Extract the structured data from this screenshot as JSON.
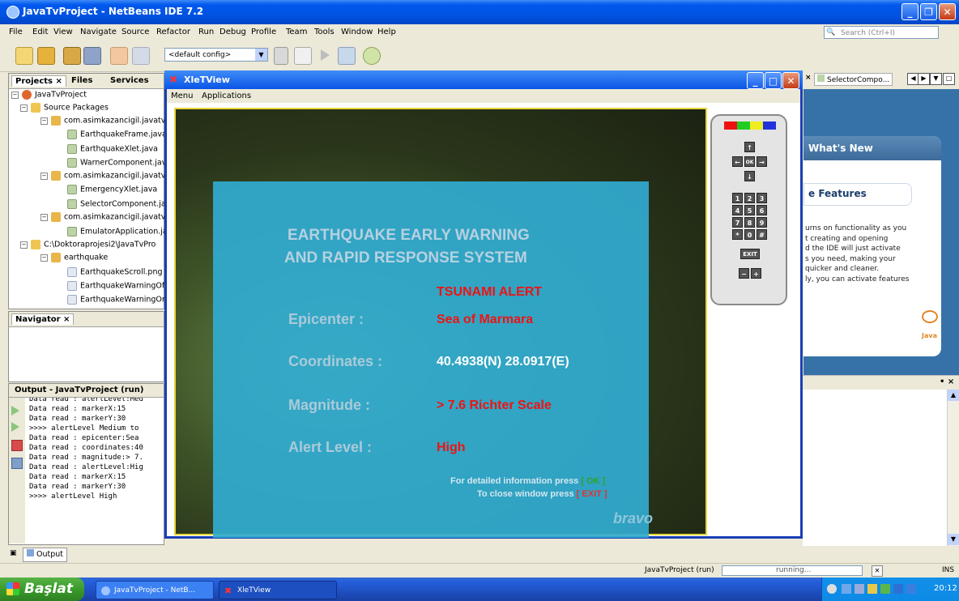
{
  "window": {
    "title": "JavaTvProject - NetBeans IDE 7.2"
  },
  "menu": [
    "File",
    "Edit",
    "View",
    "Navigate",
    "Source",
    "Refactor",
    "Run",
    "Debug",
    "Profile",
    "Team",
    "Tools",
    "Window",
    "Help"
  ],
  "search": {
    "placeholder": "Search (Ctrl+I)"
  },
  "toolbar": {
    "config": "<default config>"
  },
  "projects": {
    "tabs": [
      "Projects ×",
      "Files",
      "Services"
    ],
    "tree": [
      "JavaTvProject",
      "Source Packages",
      "com.asimkazancigil.javatv",
      "EarthquakeFrame.java",
      "EarthquakeXlet.java",
      "WarnerComponent.java",
      "com.asimkazancigil.javatv",
      "EmergencyXlet.java",
      "SelectorComponent.java",
      "com.asimkazancigil.javatv",
      "EmulatorApplication.java",
      "C:\\Doktoraprojesi2\\JavaTvPro",
      "earthquake",
      "EarthquakeScroll.png",
      "EarthquakeWarningOf",
      "EarthquakeWarningOr"
    ]
  },
  "navigator": {
    "title": "Navigator ×"
  },
  "output": {
    "title": "Output - JavaTvProject (run)",
    "lines": [
      "Data read : alertLevel:Med",
      "Data read : markerX:15",
      "Data read : markerY:30",
      ">>>> alertLevel Medium to",
      "Data read : epicenter:Sea",
      "Data read : coordinates:40",
      "Data read : magnitude:> 7.",
      "Data read : alertLevel:Hig",
      "Data read : markerX:15",
      "Data read : markerY:30",
      ">>>> alertLevel High"
    ],
    "tab": "Output"
  },
  "editor_tab": {
    "label": "SelectorCompo..."
  },
  "start_page": {
    "whats_new": "What's New",
    "features": "e Features",
    "body": [
      "urns on functionality as you",
      "t creating and opening",
      "d the IDE will just activate",
      "s you need, making your",
      "quicker and cleaner.",
      "ly, you can activate features"
    ],
    "java_logo": "Java"
  },
  "xlet": {
    "title": "XleTView",
    "menu": [
      "Menu",
      "Applications"
    ],
    "heading1": "EARTHQUAKE EARLY WARNING",
    "heading2": "AND RAPID RESPONSE SYSTEM",
    "alert": "TSUNAMI ALERT",
    "epicenter_label": "Epicenter :",
    "epicenter_value": "Sea of Marmara",
    "coordinates_label": "Coordinates :",
    "coordinates_value": "40.4938(N) 28.0917(E)",
    "magnitude_label": "Magnitude :",
    "magnitude_value": "> 7.6 Richter Scale",
    "alert_level_label": "Alert Level :",
    "alert_level_value": "High",
    "hint1_text": "For detailed information press",
    "hint1_key": "[ OK ]",
    "hint2_text": "To close window press",
    "hint2_key": "[ EXIT ]",
    "watermark": "bravo"
  },
  "remote": {
    "colors": [
      "#e11",
      "#2c2",
      "#ee2",
      "#23d"
    ],
    "keys": [
      "1",
      "2",
      "3",
      "4",
      "5",
      "6",
      "7",
      "8",
      "9",
      "*",
      "0",
      "#"
    ],
    "ok": "OK",
    "exit": "EXIT",
    "minus": "−",
    "plus": "+"
  },
  "status": {
    "project": "JavaTvProject (run)",
    "progress": "running...",
    "mode": "INS"
  },
  "taskbar": {
    "start": "Başlat",
    "task1": "JavaTvProject - NetB...",
    "task2": "XleTView",
    "clock": "20:12"
  }
}
